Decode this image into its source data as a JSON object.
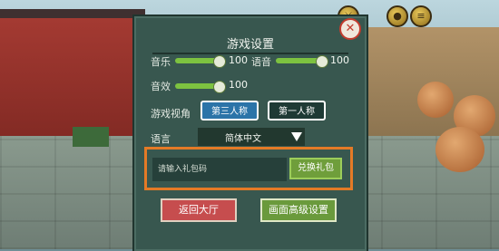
{
  "dialog": {
    "title": "游戏设置",
    "close_icon": "close-icon"
  },
  "settings": {
    "music": {
      "label": "音乐",
      "value": 100
    },
    "voice": {
      "label": "语音",
      "value": 100
    },
    "sfx": {
      "label": "音效",
      "value": 100
    },
    "view": {
      "label": "游戏视角",
      "third_person": "第三人称",
      "first_person": "第一人称",
      "selected": "第三人称"
    },
    "language": {
      "label": "语言",
      "value": "简体中文",
      "dropdown_icon": "dropdown-arrow-icon"
    }
  },
  "gift": {
    "placeholder": "请输入礼包码",
    "redeem_label": "兑换礼包"
  },
  "footer": {
    "back_label": "返回大厅",
    "advanced_label": "画面高级设置"
  },
  "colors": {
    "panel": "#38574f",
    "accent_highlight": "#e47a26",
    "slider": "#7dc240",
    "selected_view": "#2b74a8"
  }
}
